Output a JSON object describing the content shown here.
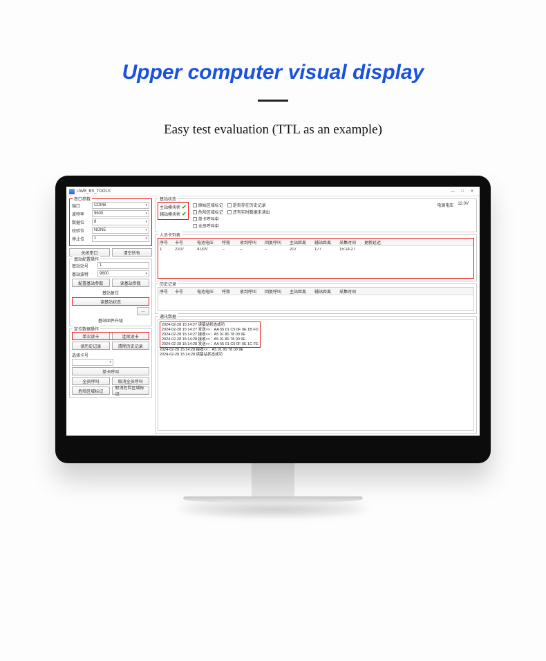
{
  "page": {
    "title": "Upper computer visual display",
    "subtitle": "Easy test evaluation (TTL as an example)"
  },
  "window": {
    "title": "UWB_BS_TOOLS",
    "min": "—",
    "max": "□",
    "close": "✕"
  },
  "serial": {
    "group": "串口参数",
    "port_label": "端口",
    "port_value": "COM6",
    "baud_label": "波特率",
    "baud_value": "9600",
    "data_label": "数据位",
    "data_value": "8",
    "parity_label": "校验位",
    "parity_value": "NONE",
    "stop_label": "停止位",
    "stop_value": "1",
    "btn_close": "关闭串口",
    "btn_clear": "清空所有"
  },
  "config": {
    "group": "基站配置操作",
    "station_label": "基站站号",
    "station_value": "1",
    "baud_label": "基站波特",
    "baud_value": "9600",
    "btn_set_params": "配置基站参数",
    "btn_read_params": "读基站参数",
    "reset_group": "基站复位",
    "btn_read_status": "读基站状态",
    "btn_dots": "…",
    "fw_group": "基站固件升级"
  },
  "locate": {
    "group": "定位数据操作",
    "btn_single_read": "单次读卡",
    "btn_cont_read": "连续读卡",
    "btn_read_history": "读历史记录",
    "btn_clear_history": "清除历史记录",
    "select_group": "选择卡号",
    "btn_single_call": "单卡呼叫",
    "btn_all_call": "全员呼叫",
    "btn_cancel_all": "取消全员呼叫",
    "btn_danger_mark": "危险区域标记",
    "btn_cancel_danger": "取消危险区域标记"
  },
  "station_status": {
    "group": "基站状态",
    "main_label": "主站模块状",
    "aux_label": "辅站模块状",
    "chk1": "原始区域标记",
    "chk2": "危险区域标记",
    "chk3": "单卡呼叫中",
    "chk4": "全员呼叫中",
    "chk5": "是否存在历史记录",
    "chk6": "还有实时数据未读出",
    "voltage_label": "电源电压",
    "voltage_value": "12.0V"
  },
  "card_list": {
    "group": "人员卡列表",
    "headers": [
      "序号",
      "卡号",
      "电池电压",
      "呼救",
      "收到呼叫",
      "回复呼叫",
      "主站距离",
      "辅站距离",
      "采集时间",
      "更新延迟"
    ],
    "rows": [
      {
        "c": [
          "1",
          "2207",
          "4.00V",
          "--",
          "--",
          "--",
          "207",
          "177",
          "15:14:27",
          ""
        ]
      }
    ]
  },
  "history_list": {
    "group": "历史记录",
    "headers": [
      "序号",
      "卡号",
      "电池电压",
      "呼救",
      "收到呼叫",
      "回复呼叫",
      "主站距离",
      "辅站距离",
      "采集时间"
    ]
  },
  "comm": {
    "group": "通讯数据",
    "lines": [
      "2024-02-28 15:14:27 读基站状态成功",
      "2024-02-28 15:14:27 发送>>：AA 55 01 C5 0F 0E 1B FD",
      "2024-02-28 15:14:27 接收<<：A5 01 80 78 00 9E",
      "2024-02-28 15:14:28 接收<<：A5 01 80 78 00 9E",
      "2024-02-28 15:14:28 发送>>：AA 55 01 C5 0F 0E 1C FE",
      "2024-02-28 15:14:28 接收<<：A5 01 80 78 00 9E",
      "2024-02-28 15:14:28 读基站状态成功"
    ]
  }
}
